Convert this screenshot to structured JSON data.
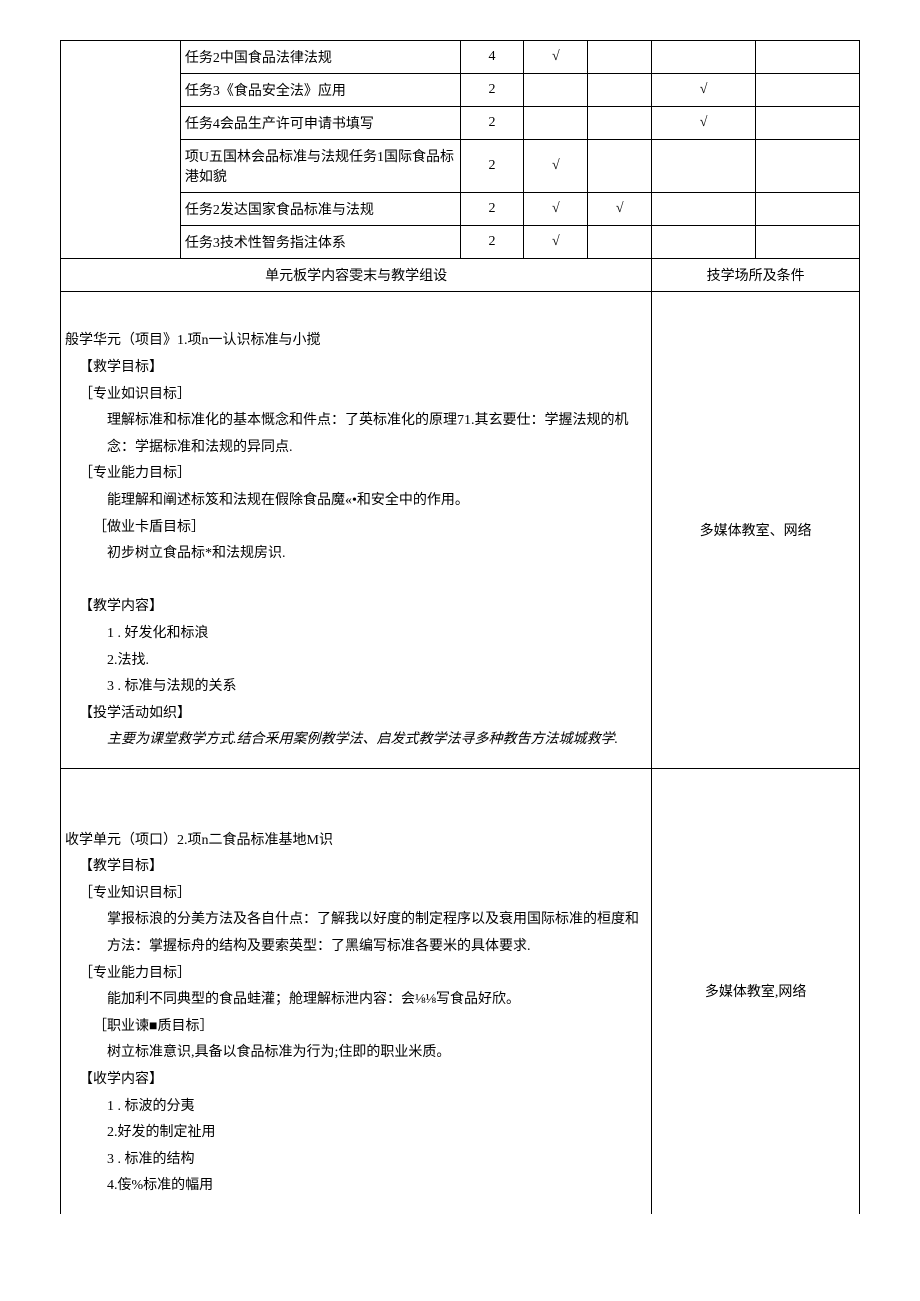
{
  "rows": [
    {
      "task": "任务2中国食品法律法规",
      "h": "4",
      "c1": "√",
      "c2": "",
      "c3": "",
      "c4": ""
    },
    {
      "task": "任务3《食品安全法》应用",
      "h": "2",
      "c1": "",
      "c2": "",
      "c3": "√",
      "c4": ""
    },
    {
      "task": "任务4会品生产许可申请书填写",
      "h": "2",
      "c1": "",
      "c2": "",
      "c3": "√",
      "c4": ""
    },
    {
      "task": "项U五国林会品标准与法规任务1国际食品标港如貌",
      "h": "2",
      "c1": "√",
      "c2": "",
      "c3": "",
      "c4": ""
    },
    {
      "task": "任务2发达国家食品标准与法规",
      "h": "2",
      "c1": "√",
      "c2": "√",
      "c3": "",
      "c4": ""
    },
    {
      "task": "任务3技术性智务指注体系",
      "h": "2",
      "c1": "√",
      "c2": "",
      "c3": "",
      "c4": ""
    }
  ],
  "secHeader": {
    "left": "单元板学内容雯末与教学组设",
    "right": "技学场所及条件"
  },
  "unit1": {
    "title": "般学华元（项目》1.项n一认识标准与小搅",
    "goalH": "【救学目标】",
    "knowH": "［专业如识目标］",
    "know": "理解标准和标准化的基本慨念和件点：了英标准化的原理71.其玄要仕：学握法规的机念：学据标准和法规的异同点.",
    "ablH": "［专业能力目标］",
    "abl": "能理解和阐述标笈和法规在假除食品魔«•和安全中的作用。",
    "jobH": "［做业卡盾目标］",
    "job": "初步树立食品标*和法规房识.",
    "contH": "【教学内容】",
    "c1": "1            . 好发化和标浪",
    "c2": "2.法找.",
    "c3": "3            . 标准与法规的关系",
    "actH": "【投学活动如织】",
    "act": "主要为课堂救学方式.结合釆用案例教学法、启发式教学法寻多种教吿方法城城救学.",
    "place": "多媒体教室、网络"
  },
  "unit2": {
    "title": "收学单元（项口）2.项n二食品标准基地M识",
    "goalH": "【教学目标】",
    "knowH": "［专业知识目标］",
    "know": "掌报标浪的分美方法及各自什点：了解我以好度的制定程序以及衰用国际标准的桓度和方法：掌握标舟的结构及要索英型：了黑编写标准各要米的具体要求.",
    "ablH": "［专业能力目标］",
    "abl": "能加利不同典型的食品蛙灌；舱理解标泄内容：会⅛⅛写食品好欣。",
    "jobH": "［职业谏■质目标］",
    "job": "树立标准意识,具备以食品标准为行为;住即的职业米质。",
    "contH": "【收学内容】",
    "c1": "1            . 标波的分夷",
    "c2": "2.好发的制定祉用",
    "c3": "3            . 标准的结构",
    "c4": "4.侫%标准的幅用",
    "place": "多媒体教室,网络"
  }
}
